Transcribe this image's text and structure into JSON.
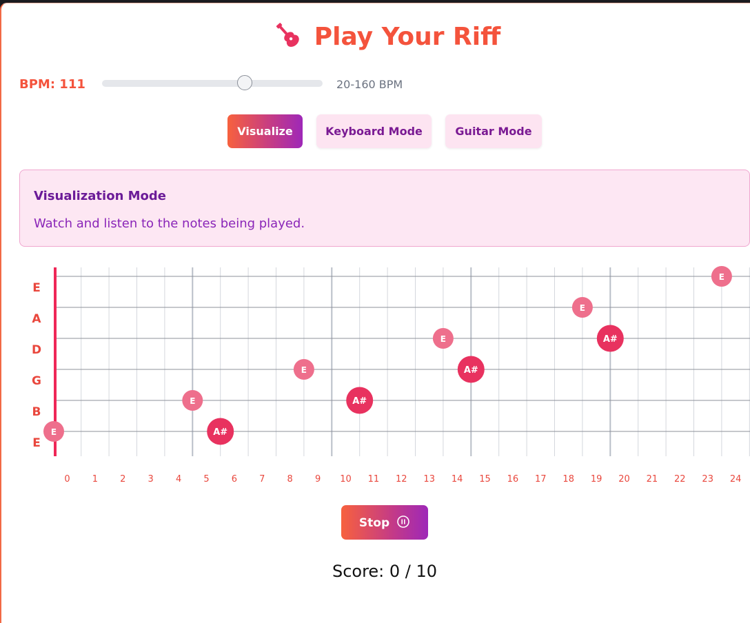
{
  "header": {
    "title": "Play Your Riff",
    "icon": "guitar-icon"
  },
  "tempo": {
    "bpm_label": "BPM: 111",
    "bpm": 111,
    "min": 20,
    "max": 160,
    "range_hint": "20-160 BPM"
  },
  "modes": {
    "visualize_label": "Visualize",
    "keyboard_label": "Keyboard Mode",
    "guitar_label": "Guitar Mode",
    "active": "visualize"
  },
  "info": {
    "title": "Visualization Mode",
    "text": "Watch and listen to the notes being played."
  },
  "fretboard": {
    "strings": [
      "E",
      "A",
      "D",
      "G",
      "B",
      "E"
    ],
    "frets": [
      "0",
      "1",
      "2",
      "3",
      "4",
      "5",
      "6",
      "7",
      "8",
      "9",
      "10",
      "11",
      "12",
      "13",
      "14",
      "15",
      "16",
      "17",
      "18",
      "19",
      "20",
      "21",
      "22",
      "23",
      "24"
    ],
    "notes": [
      {
        "label": "E",
        "string": 0,
        "fret": 23.5,
        "kind": "secondary"
      },
      {
        "label": "E",
        "string": 1,
        "fret": 18.5,
        "kind": "secondary"
      },
      {
        "label": "A#",
        "string": 2,
        "fret": 19.5,
        "kind": "primary"
      },
      {
        "label": "E",
        "string": 2,
        "fret": 13.5,
        "kind": "secondary"
      },
      {
        "label": "A#",
        "string": 3,
        "fret": 14.5,
        "kind": "primary"
      },
      {
        "label": "E",
        "string": 3,
        "fret": 8.5,
        "kind": "secondary"
      },
      {
        "label": "A#",
        "string": 4,
        "fret": 10.5,
        "kind": "primary"
      },
      {
        "label": "E",
        "string": 4,
        "fret": 4.5,
        "kind": "secondary"
      },
      {
        "label": "A#",
        "string": 5,
        "fret": 5.5,
        "kind": "primary"
      },
      {
        "label": "E",
        "string": 5,
        "fret": 0,
        "kind": "secondary"
      }
    ],
    "colors": {
      "primary": "#e8325f",
      "secondary": "#ee6f8c",
      "nut": "#ef2757",
      "label": "#e9473d"
    }
  },
  "playback": {
    "stop_label": "Stop",
    "stop_icon": "pause-circle-icon"
  },
  "score": {
    "text": "Score: 0 / 10"
  }
}
